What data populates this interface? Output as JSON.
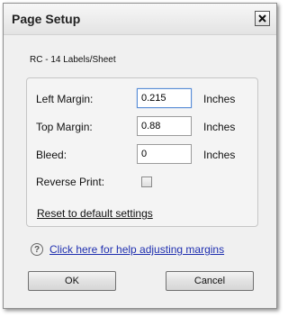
{
  "dialog": {
    "title": "Page Setup",
    "close_label": "X",
    "subtitle": "RC - 14 Labels/Sheet"
  },
  "margins": {
    "left": {
      "label": "Left Margin:",
      "value": "0.215",
      "unit": "Inches"
    },
    "top": {
      "label": "Top Margin:",
      "value": "0.88",
      "unit": "Inches"
    },
    "bleed": {
      "label": "Bleed:",
      "value": "0",
      "unit": "Inches"
    },
    "reverse_print": {
      "label": "Reverse Print:",
      "checked": false
    },
    "reset_label": "Reset to default settings"
  },
  "help": {
    "icon": "question-circle-icon",
    "icon_glyph": "?",
    "link_text": "Click here for help adjusting margins"
  },
  "buttons": {
    "ok": "OK",
    "cancel": "Cancel"
  },
  "colors": {
    "link": "#2030b0",
    "focus_border": "#5a8ed6"
  }
}
